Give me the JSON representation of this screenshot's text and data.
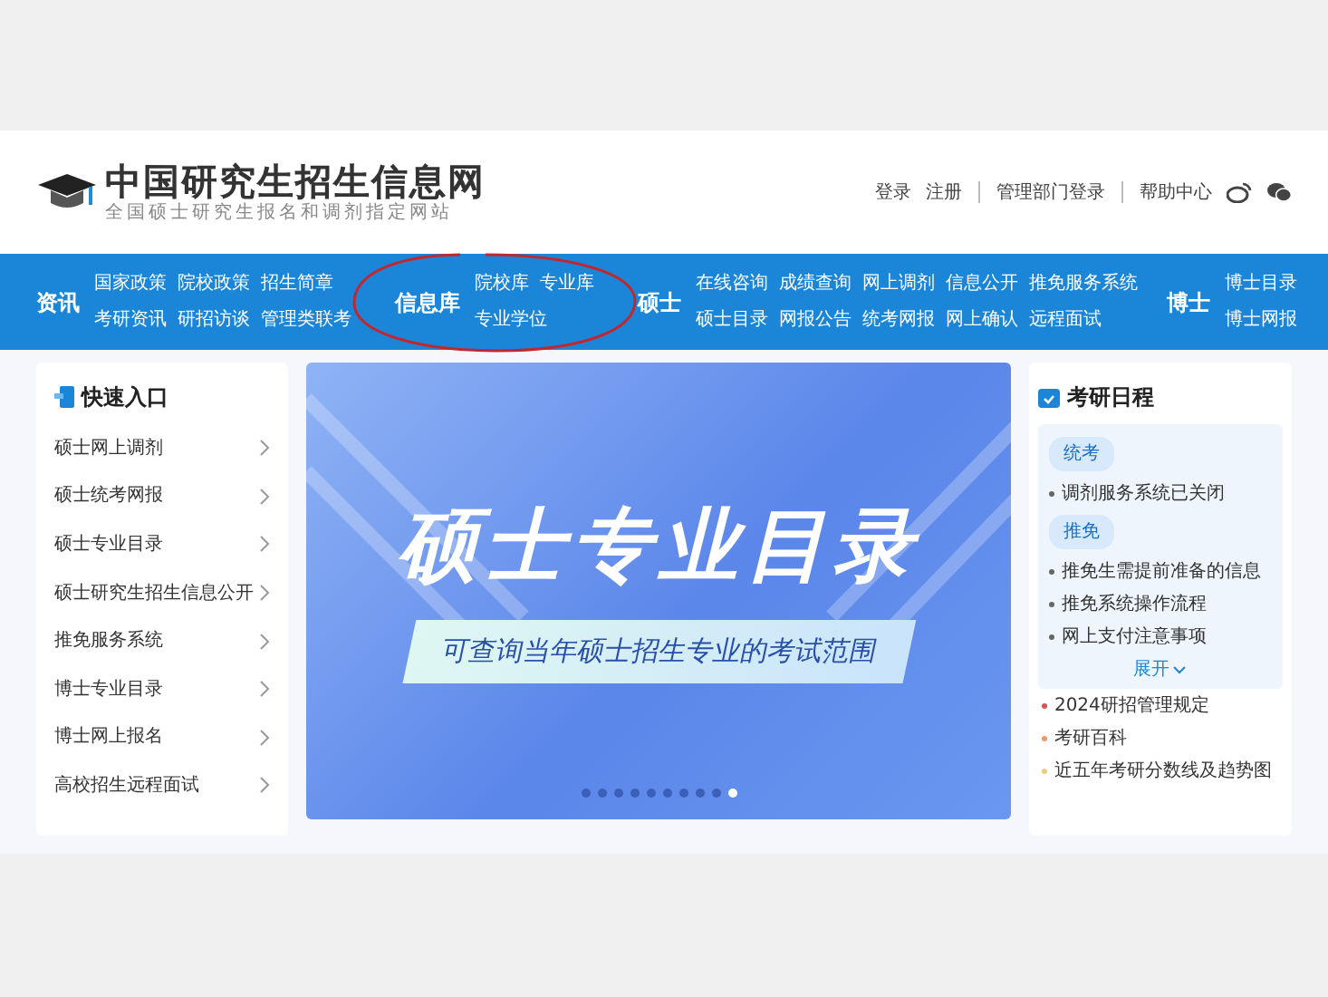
{
  "header": {
    "site_title": "中国研究生招生信息网",
    "site_subtitle": "全国硕士研究生报名和调剂指定网站",
    "links": [
      "登录",
      "注册",
      "管理部门登录",
      "帮助中心"
    ]
  },
  "nav": [
    {
      "label": "资讯",
      "links": [
        [
          "国家政策",
          "院校政策",
          "招生简章"
        ],
        [
          "考研资讯",
          "研招访谈",
          "管理类联考"
        ]
      ]
    },
    {
      "label": "信息库",
      "circled": true,
      "links": [
        [
          "院校库",
          "专业库"
        ],
        [
          "专业学位"
        ]
      ]
    },
    {
      "label": "硕士",
      "links": [
        [
          "在线咨询",
          "成绩查询",
          "网上调剂",
          "信息公开",
          "推免服务系统"
        ],
        [
          "硕士目录",
          "网报公告",
          "统考网报",
          "网上确认",
          "远程面试"
        ]
      ]
    },
    {
      "label": "博士",
      "links": [
        [
          "博士目录"
        ],
        [
          "博士网报"
        ]
      ]
    }
  ],
  "quick_entry": {
    "title": "快速入口",
    "items": [
      "硕士网上调剂",
      "硕士统考网报",
      "硕士专业目录",
      "硕士研究生招生信息公开",
      "推免服务系统",
      "博士专业目录",
      "博士网上报名",
      "高校招生远程面试"
    ]
  },
  "banner": {
    "title": "硕士专业目录",
    "subtitle": "可查询当年硕士招生专业的考试范围",
    "dots": [
      {
        "selected": false
      },
      {
        "selected": false
      },
      {
        "selected": false
      },
      {
        "selected": false
      },
      {
        "selected": false
      },
      {
        "selected": false
      },
      {
        "selected": false
      },
      {
        "selected": false
      },
      {
        "selected": false
      },
      {
        "selected": true
      }
    ]
  },
  "schedule": {
    "title": "考研日程",
    "sections": [
      {
        "tag": "统考",
        "items": [
          "调剂服务系统已关闭"
        ]
      },
      {
        "tag": "推免",
        "items": [
          "推免生需提前准备的信息",
          "推免系统操作流程",
          "网上支付注意事项"
        ]
      }
    ],
    "expand_label": "展开",
    "expanded": false,
    "links": [
      {
        "text": "2024研招管理规定",
        "color": "#d9534f"
      },
      {
        "text": "考研百科",
        "color": "#e89a6a"
      },
      {
        "text": "近五年考研分数线及趋势图",
        "color": "#e8cf7a"
      }
    ]
  }
}
